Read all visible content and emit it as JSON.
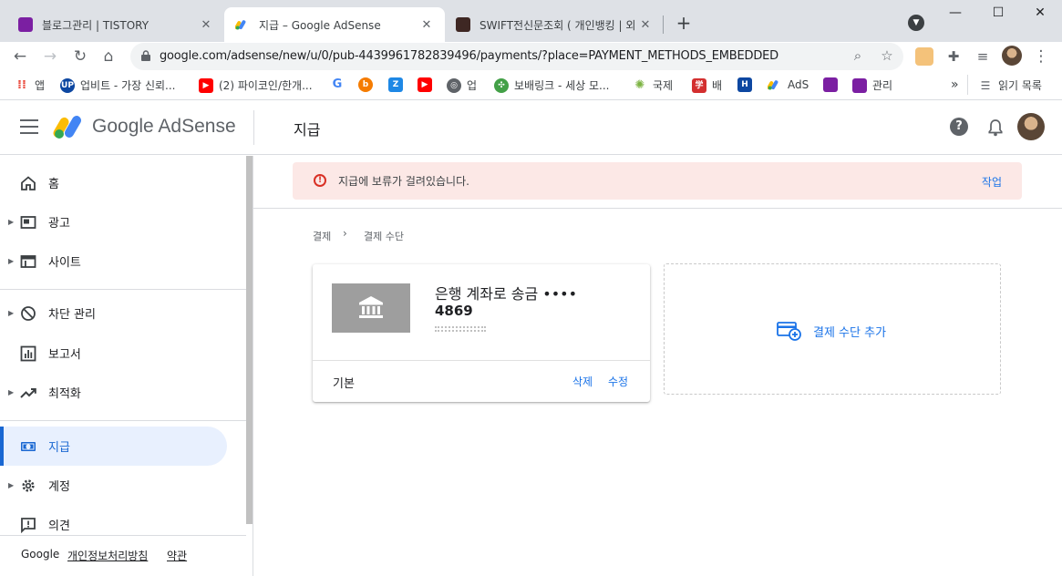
{
  "browser": {
    "tabs": [
      {
        "title": "블로그관리 | TISTORY",
        "favicon_color": "#7b1fa2"
      },
      {
        "title": "지급 – Google AdSense",
        "favicon_color": "#fbbc04"
      },
      {
        "title": "SWIFT전신문조회 ( 개인뱅킹 | 외",
        "favicon_color": "#3e2723"
      }
    ],
    "new_tab_label": "+",
    "url": "google.com/adsense/new/u/0/pub-4439961782839496/payments/?place=PAYMENT_METHODS_EMBEDDED",
    "window_controls": {
      "minimize": "—",
      "maximize": "☐",
      "close": "✕"
    }
  },
  "bookmarks": [
    {
      "label": "앱",
      "icon": "apps-grid-icon",
      "color": "#ea4335"
    },
    {
      "label": "업비트 - 가장 신뢰...",
      "icon": "upbit-icon",
      "color": "#0d47a1"
    },
    {
      "label": "(2) 파이코인/한개...",
      "icon": "youtube-icon",
      "color": "#ff0000"
    },
    {
      "label": "",
      "icon": "google-icon",
      "color": "#4285f4"
    },
    {
      "label": "",
      "icon": "blogger-icon",
      "color": "#f57c00"
    },
    {
      "label": "",
      "icon": "zum-icon",
      "color": "#1e88e5"
    },
    {
      "label": "",
      "icon": "youtube-icon",
      "color": "#ff0000"
    },
    {
      "label": "업",
      "icon": "globe-icon",
      "color": "#5f6368"
    },
    {
      "label": "보배링크 - 세상 모...",
      "icon": "pinwheel-icon",
      "color": "#43a047"
    },
    {
      "label": "국제",
      "icon": "sun-icon",
      "color": "#7cb342"
    },
    {
      "label": "배",
      "icon": "red-stamp-icon",
      "color": "#d32f2f"
    },
    {
      "label": "",
      "icon": "h-icon",
      "color": "#0d47a1"
    },
    {
      "label": "AdS",
      "icon": "adsense-icon",
      "color": "#fbbc04"
    },
    {
      "label": "",
      "icon": "tistory-icon",
      "color": "#7b1fa2"
    },
    {
      "label": "관리",
      "icon": "tistory-icon",
      "color": "#7b1fa2"
    }
  ],
  "bookmarks_more": "»",
  "reading_list": "읽기 목록",
  "adsense": {
    "brand": "Google AdSense",
    "page_title": "지급",
    "help_label": "?",
    "sidebar": [
      {
        "label": "홈",
        "icon": "home-icon",
        "caret": false
      },
      {
        "label": "광고",
        "icon": "ads-icon",
        "caret": true
      },
      {
        "label": "사이트",
        "icon": "sites-icon",
        "caret": true
      },
      {
        "label": "차단 관리",
        "icon": "block-icon",
        "caret": true
      },
      {
        "label": "보고서",
        "icon": "reports-icon",
        "caret": false
      },
      {
        "label": "최적화",
        "icon": "optimization-icon",
        "caret": true
      },
      {
        "label": "지급",
        "icon": "payments-icon",
        "caret": false,
        "active": true
      },
      {
        "label": "계정",
        "icon": "gear-icon",
        "caret": true
      },
      {
        "label": "의견",
        "icon": "feedback-icon",
        "caret": false
      }
    ],
    "footer": {
      "google": "Google",
      "privacy": "개인정보처리방침",
      "terms": "약관"
    },
    "alert": {
      "text": "지급에 보류가 걸려있습니다.",
      "action": "작업"
    },
    "breadcrumb": {
      "root": "결제",
      "separator": "›",
      "current": "결제 수단"
    },
    "payment_card": {
      "title": "은행 계좌로 송금 ••••",
      "number": "4869",
      "default_label": "기본",
      "delete_label": "삭제",
      "edit_label": "수정"
    },
    "add_payment": {
      "label": "결제 수단 추가"
    }
  },
  "colors": {
    "accent": "#1a73e8",
    "active_nav": "#1967d2",
    "alert_bg": "#fce8e6",
    "alert_icon": "#d93025"
  }
}
